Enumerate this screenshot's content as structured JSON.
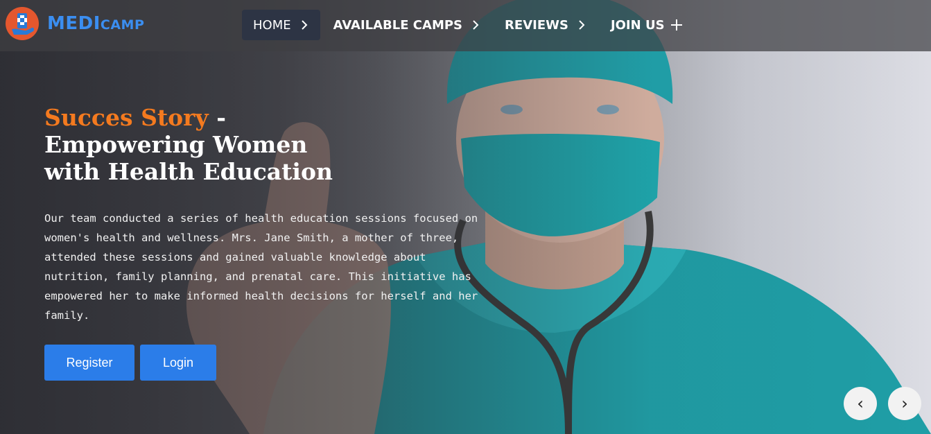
{
  "brand": {
    "name_main": "MEDI",
    "name_small": "CAMP"
  },
  "nav": {
    "items": [
      {
        "label": "HOME",
        "icon": "chevron-right-icon",
        "active": true
      },
      {
        "label": "AVAILABLE CAMPS",
        "icon": "chevron-right-icon",
        "active": false
      },
      {
        "label": "REVIEWS",
        "icon": "chevron-right-icon",
        "active": false
      },
      {
        "label": "JOIN US",
        "icon": "plus-icon",
        "active": false
      }
    ]
  },
  "hero": {
    "accent_title": "Succes Story",
    "separator": " -",
    "title_line1": "Empowering Women",
    "title_line2": "with Health Education",
    "description": "Our team conducted a series of health education sessions focused on women's health and wellness. Mrs. Jane Smith, a mother of three, attended these sessions and gained valuable knowledge about nutrition, family planning, and prenatal care. This initiative has empowered her to make informed health decisions for herself and her family.",
    "register_label": "Register",
    "login_label": "Login"
  },
  "carousel": {
    "prev_label": "‹",
    "next_label": "›"
  },
  "colors": {
    "accent_orange": "#f47a1f",
    "brand_blue": "#3b8ef0",
    "button_blue": "#2b7de9",
    "logo_orange": "#e4572e"
  }
}
